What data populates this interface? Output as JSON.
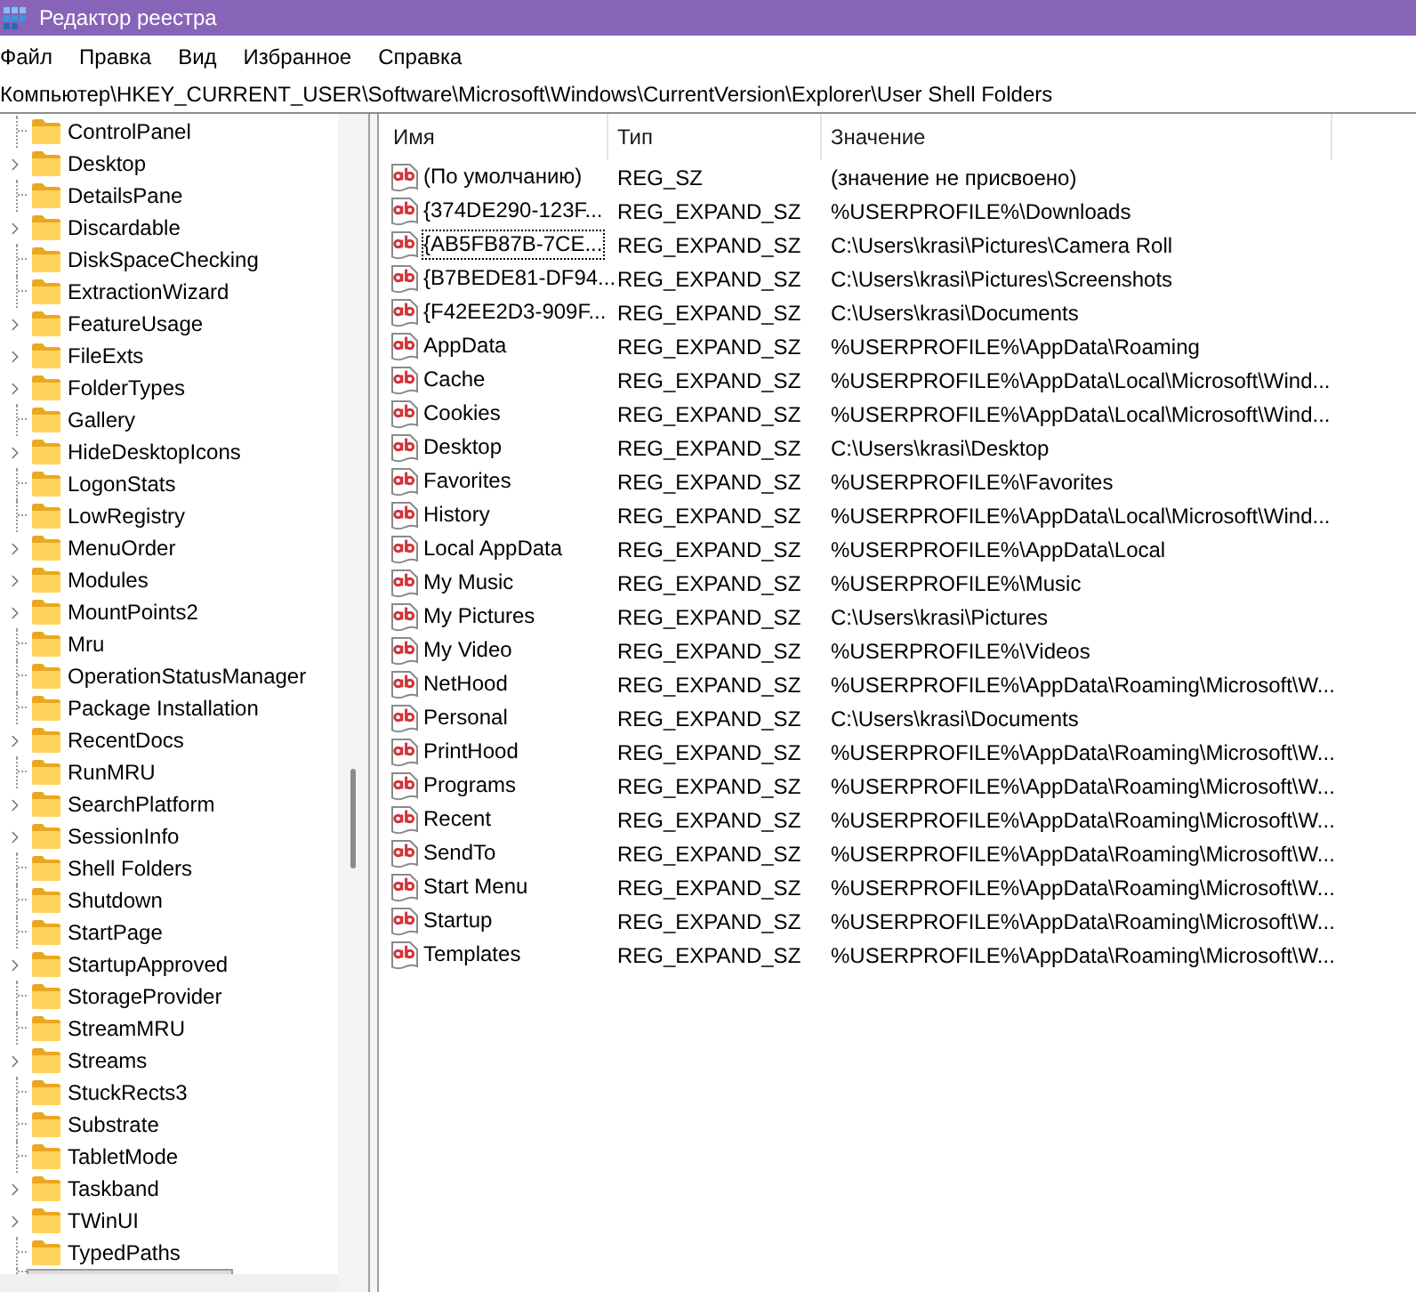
{
  "window": {
    "title": "Редактор реестра"
  },
  "menu": [
    "Файл",
    "Правка",
    "Вид",
    "Избранное",
    "Справка"
  ],
  "address_bar": {
    "value": "Компьютер\\HKEY_CURRENT_USER\\Software\\Microsoft\\Windows\\CurrentVersion\\Explorer\\User Shell Folders"
  },
  "tree": {
    "items": [
      {
        "label": "ControlPanel",
        "expandable": false,
        "selected": false
      },
      {
        "label": "Desktop",
        "expandable": true,
        "selected": false
      },
      {
        "label": "DetailsPane",
        "expandable": false,
        "selected": false
      },
      {
        "label": "Discardable",
        "expandable": true,
        "selected": false
      },
      {
        "label": "DiskSpaceChecking",
        "expandable": false,
        "selected": false
      },
      {
        "label": "ExtractionWizard",
        "expandable": false,
        "selected": false
      },
      {
        "label": "FeatureUsage",
        "expandable": true,
        "selected": false
      },
      {
        "label": "FileExts",
        "expandable": true,
        "selected": false
      },
      {
        "label": "FolderTypes",
        "expandable": true,
        "selected": false
      },
      {
        "label": "Gallery",
        "expandable": false,
        "selected": false
      },
      {
        "label": "HideDesktopIcons",
        "expandable": true,
        "selected": false
      },
      {
        "label": "LogonStats",
        "expandable": false,
        "selected": false
      },
      {
        "label": "LowRegistry",
        "expandable": false,
        "selected": false
      },
      {
        "label": "MenuOrder",
        "expandable": true,
        "selected": false
      },
      {
        "label": "Modules",
        "expandable": true,
        "selected": false
      },
      {
        "label": "MountPoints2",
        "expandable": true,
        "selected": false
      },
      {
        "label": "Mru",
        "expandable": false,
        "selected": false
      },
      {
        "label": "OperationStatusManager",
        "expandable": false,
        "selected": false
      },
      {
        "label": "Package Installation",
        "expandable": false,
        "selected": false
      },
      {
        "label": "RecentDocs",
        "expandable": true,
        "selected": false
      },
      {
        "label": "RunMRU",
        "expandable": false,
        "selected": false
      },
      {
        "label": "SearchPlatform",
        "expandable": true,
        "selected": false
      },
      {
        "label": "SessionInfo",
        "expandable": true,
        "selected": false
      },
      {
        "label": "Shell Folders",
        "expandable": false,
        "selected": false
      },
      {
        "label": "Shutdown",
        "expandable": false,
        "selected": false
      },
      {
        "label": "StartPage",
        "expandable": false,
        "selected": false
      },
      {
        "label": "StartupApproved",
        "expandable": true,
        "selected": false
      },
      {
        "label": "StorageProvider",
        "expandable": false,
        "selected": false
      },
      {
        "label": "StreamMRU",
        "expandable": false,
        "selected": false
      },
      {
        "label": "Streams",
        "expandable": true,
        "selected": false
      },
      {
        "label": "StuckRects3",
        "expandable": false,
        "selected": false
      },
      {
        "label": "Substrate",
        "expandable": false,
        "selected": false
      },
      {
        "label": "TabletMode",
        "expandable": false,
        "selected": false
      },
      {
        "label": "Taskband",
        "expandable": true,
        "selected": false
      },
      {
        "label": "TWinUI",
        "expandable": true,
        "selected": false
      },
      {
        "label": "TypedPaths",
        "expandable": false,
        "selected": false
      },
      {
        "expandable": false,
        "selected": true
      }
    ]
  },
  "values": {
    "columns": [
      "Имя",
      "Тип",
      "Значение"
    ],
    "rows": [
      {
        "name": "(По умолчанию)",
        "type": "REG_SZ",
        "value": "(значение не присвоено)",
        "focused": false
      },
      {
        "name": "{374DE290-123F...",
        "type": "REG_EXPAND_SZ",
        "value": "%USERPROFILE%\\Downloads",
        "focused": false
      },
      {
        "name": "{AB5FB87B-7CE...",
        "type": "REG_EXPAND_SZ",
        "value": "C:\\Users\\krasi\\Pictures\\Camera Roll",
        "focused": true
      },
      {
        "name": "{B7BEDE81-DF94...",
        "type": "REG_EXPAND_SZ",
        "value": "C:\\Users\\krasi\\Pictures\\Screenshots",
        "focused": false
      },
      {
        "name": "{F42EE2D3-909F...",
        "type": "REG_EXPAND_SZ",
        "value": "C:\\Users\\krasi\\Documents",
        "focused": false
      },
      {
        "name": "AppData",
        "type": "REG_EXPAND_SZ",
        "value": "%USERPROFILE%\\AppData\\Roaming",
        "focused": false
      },
      {
        "name": "Cache",
        "type": "REG_EXPAND_SZ",
        "value": "%USERPROFILE%\\AppData\\Local\\Microsoft\\Wind...",
        "focused": false
      },
      {
        "name": "Cookies",
        "type": "REG_EXPAND_SZ",
        "value": "%USERPROFILE%\\AppData\\Local\\Microsoft\\Wind...",
        "focused": false
      },
      {
        "name": "Desktop",
        "type": "REG_EXPAND_SZ",
        "value": "C:\\Users\\krasi\\Desktop",
        "focused": false
      },
      {
        "name": "Favorites",
        "type": "REG_EXPAND_SZ",
        "value": "%USERPROFILE%\\Favorites",
        "focused": false
      },
      {
        "name": "History",
        "type": "REG_EXPAND_SZ",
        "value": "%USERPROFILE%\\AppData\\Local\\Microsoft\\Wind...",
        "focused": false
      },
      {
        "name": "Local AppData",
        "type": "REG_EXPAND_SZ",
        "value": "%USERPROFILE%\\AppData\\Local",
        "focused": false
      },
      {
        "name": "My Music",
        "type": "REG_EXPAND_SZ",
        "value": "%USERPROFILE%\\Music",
        "focused": false
      },
      {
        "name": "My Pictures",
        "type": "REG_EXPAND_SZ",
        "value": "C:\\Users\\krasi\\Pictures",
        "focused": false
      },
      {
        "name": "My Video",
        "type": "REG_EXPAND_SZ",
        "value": "%USERPROFILE%\\Videos",
        "focused": false
      },
      {
        "name": "NetHood",
        "type": "REG_EXPAND_SZ",
        "value": "%USERPROFILE%\\AppData\\Roaming\\Microsoft\\W...",
        "focused": false
      },
      {
        "name": "Personal",
        "type": "REG_EXPAND_SZ",
        "value": "C:\\Users\\krasi\\Documents",
        "focused": false
      },
      {
        "name": "PrintHood",
        "type": "REG_EXPAND_SZ",
        "value": "%USERPROFILE%\\AppData\\Roaming\\Microsoft\\W...",
        "focused": false
      },
      {
        "name": "Programs",
        "type": "REG_EXPAND_SZ",
        "value": "%USERPROFILE%\\AppData\\Roaming\\Microsoft\\W...",
        "focused": false
      },
      {
        "name": "Recent",
        "type": "REG_EXPAND_SZ",
        "value": "%USERPROFILE%\\AppData\\Roaming\\Microsoft\\W...",
        "focused": false
      },
      {
        "name": "SendTo",
        "type": "REG_EXPAND_SZ",
        "value": "%USERPROFILE%\\AppData\\Roaming\\Microsoft\\W...",
        "focused": false
      },
      {
        "name": "Start Menu",
        "type": "REG_EXPAND_SZ",
        "value": "%USERPROFILE%\\AppData\\Roaming\\Microsoft\\W...",
        "focused": false
      },
      {
        "name": "Startup",
        "type": "REG_EXPAND_SZ",
        "value": "%USERPROFILE%\\AppData\\Roaming\\Microsoft\\W...",
        "focused": false
      },
      {
        "name": "Templates",
        "type": "REG_EXPAND_SZ",
        "value": "%USERPROFILE%\\AppData\\Roaming\\Microsoft\\W...",
        "focused": false
      }
    ]
  }
}
